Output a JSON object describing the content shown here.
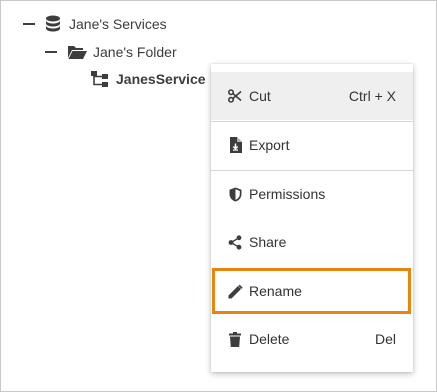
{
  "tree": {
    "root_label": "Jane's Services",
    "folder_label": "Jane's Folder",
    "service_label": "JanesService"
  },
  "menu": {
    "items": [
      {
        "label": "Cut",
        "shortcut": "Ctrl + X",
        "icon": "scissors-icon"
      },
      {
        "label": "Export",
        "icon": "export-file-icon"
      },
      {
        "label": "Permissions",
        "icon": "shield-icon"
      },
      {
        "label": "Share",
        "icon": "share-icon"
      },
      {
        "label": "Rename",
        "icon": "pencil-icon"
      },
      {
        "label": "Delete",
        "shortcut": "Del",
        "icon": "trash-icon"
      }
    ]
  },
  "colors": {
    "highlight": "#e8850f",
    "hover_bg": "#efefef",
    "icon": "#3d3d3d"
  }
}
